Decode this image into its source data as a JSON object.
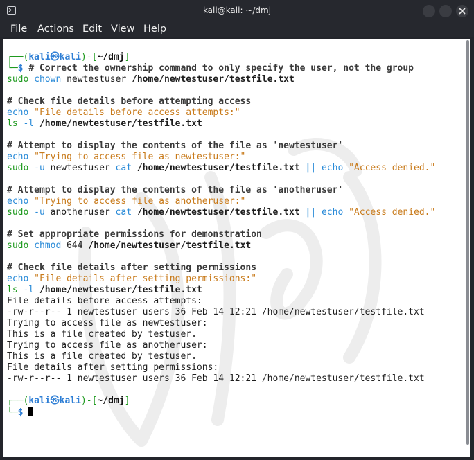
{
  "window": {
    "title": "kali@kali: ~/dmj",
    "menu": [
      "File",
      "Actions",
      "Edit",
      "View",
      "Help"
    ]
  },
  "colors": {
    "prompt_frame": "#1f9a1f",
    "user_host": "#2f7fd5",
    "string": "#c87a1a",
    "keyword": "#2a8bd8",
    "command": "#1f9a1f"
  },
  "prompt": {
    "open": "┌──(",
    "user": "kali",
    "at": "㉿",
    "host": "kali",
    "mid": ")-[",
    "dir": "~/dmj",
    "close": "]",
    "tail": "└─",
    "dollar": "$"
  },
  "script": {
    "c1": "# Correct the ownership command to only specify the user, not the group",
    "l1a": "sudo",
    "l1b": "chown",
    "l1c": " newtestuser ",
    "l1d": "/home/newtestuser/testfile.txt",
    "c2": "# Check file details before attempting access",
    "l2a": "echo",
    "l2b": " \"File details before access attempts:\"",
    "l3a": "ls",
    "l3b": " -l ",
    "l3c": "/home/newtestuser/testfile.txt",
    "c3": "# Attempt to display the contents of the file as 'newtestuser'",
    "l4a": "echo",
    "l4b": " \"Trying to access file as newtestuser:\"",
    "l5a": "sudo",
    "l5b": " -u",
    "l5c": " newtestuser ",
    "l5d": "cat",
    "l5e": " /home/newtestuser/testfile.txt ",
    "l5f": "||",
    "l5g": " echo",
    "l5h": " \"Access denied.\"",
    "c4": "# Attempt to display the contents of the file as 'anotheruser'",
    "l6a": "echo",
    "l6b": " \"Trying to access file as anotheruser:\"",
    "l7a": "sudo",
    "l7b": " -u",
    "l7c": " anotheruser ",
    "l7d": "cat",
    "l7e": " /home/newtestuser/testfile.txt ",
    "l7f": "||",
    "l7g": " echo",
    "l7h": " \"Access denied.\"",
    "c5": "# Set appropriate permissions for demonstration",
    "l8a": "sudo",
    "l8b": " chmod",
    "l8c": " 644 ",
    "l8d": "/home/newtestuser/testfile.txt",
    "c6": "# Check file details after setting permissions",
    "l9a": "echo",
    "l9b": " \"File details after setting permissions:\"",
    "l10a": "ls",
    "l10b": " -l ",
    "l10c": "/home/newtestuser/testfile.txt"
  },
  "output": [
    "File details before access attempts:",
    "-rw-r--r-- 1 newtestuser users 36 Feb 14 12:21 /home/newtestuser/testfile.txt",
    "Trying to access file as newtestuser:",
    "This is a file created by testuser.",
    "Trying to access file as anotheruser:",
    "This is a file created by testuser.",
    "File details after setting permissions:",
    "-rw-r--r-- 1 newtestuser users 36 Feb 14 12:21 /home/newtestuser/testfile.txt"
  ]
}
